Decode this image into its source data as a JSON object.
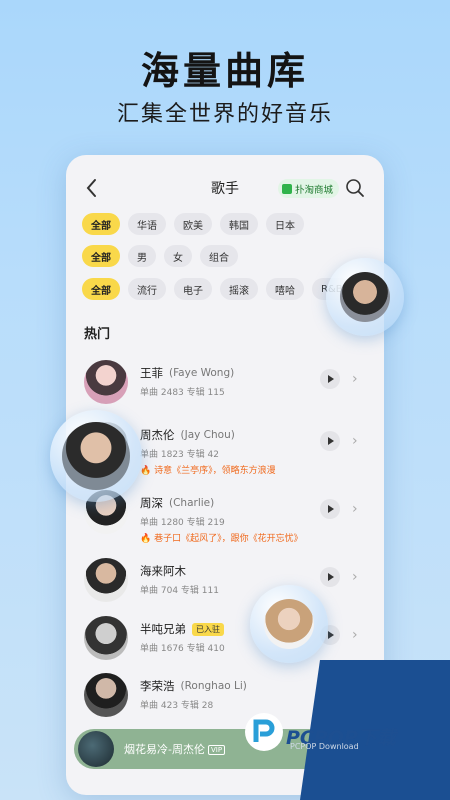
{
  "promo": {
    "headline": "海量曲库",
    "subline": "汇集全世界的好音乐"
  },
  "header": {
    "back_icon": "chevron-left-icon",
    "title": "歌手",
    "shop_label": "扑淘商城",
    "search_icon": "search-icon"
  },
  "filters": {
    "region": [
      "全部",
      "华语",
      "欧美",
      "韩国",
      "日本"
    ],
    "gender": [
      "全部",
      "男",
      "女",
      "组合"
    ],
    "genre": [
      "全部",
      "流行",
      "电子",
      "摇滚",
      "嘻哈",
      "R&B"
    ]
  },
  "section_title": "热门",
  "artists": [
    {
      "name": "王菲",
      "en": "(Faye Wong)",
      "stats": "单曲 2483  专辑 115",
      "hot": "",
      "badge": ""
    },
    {
      "name": "周杰伦",
      "en": "(Jay Chou)",
      "stats": "单曲 1823  专辑 42",
      "hot": "诗意《兰亭序》，领略东方浪漫",
      "badge": ""
    },
    {
      "name": "周深",
      "en": "(Charlie)",
      "stats": "单曲 1280  专辑 219",
      "hot": "巷子口《起风了》，跟你《花开忘忧》",
      "badge": ""
    },
    {
      "name": "海来阿木",
      "en": "",
      "stats": "单曲 704  专辑 111",
      "hot": "",
      "badge": ""
    },
    {
      "name": "半吨兄弟",
      "en": "",
      "stats": "单曲 1676  专辑 410",
      "hot": "",
      "badge": "已入驻"
    },
    {
      "name": "李荣浩",
      "en": "(Ronghao Li)",
      "stats": "单曲 423  专辑 28",
      "hot": "",
      "badge": ""
    }
  ],
  "player": {
    "now_playing": "烟花易冷-周杰伦",
    "tag": "VIP"
  },
  "watermark": {
    "brand": "PCPOP下载",
    "sub": "PCPOP Download"
  },
  "colors": {
    "accent_yellow": "#f9d84a",
    "hot_orange": "#f06a1e",
    "background_blue": "#aad7fb",
    "player_green": "#8fb393"
  }
}
